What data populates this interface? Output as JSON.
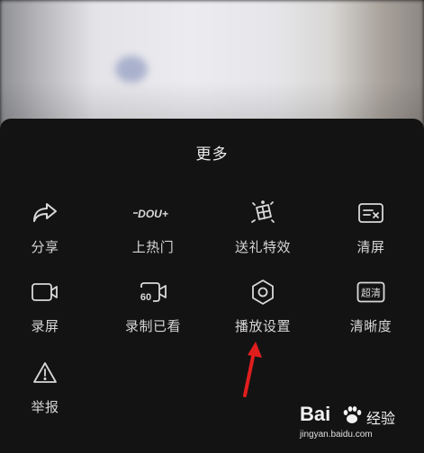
{
  "sheet": {
    "title": "更多"
  },
  "menu": [
    {
      "label": "分享",
      "icon": "share-icon"
    },
    {
      "label": "上热门",
      "icon": "dou-plus-icon"
    },
    {
      "label": "送礼特效",
      "icon": "gift-effect-icon"
    },
    {
      "label": "清屏",
      "icon": "clear-screen-icon"
    },
    {
      "label": "录屏",
      "icon": "record-screen-icon"
    },
    {
      "label": "录制已看",
      "icon": "record-watched-icon"
    },
    {
      "label": "播放设置",
      "icon": "settings-hexagon-icon"
    },
    {
      "label": "清晰度",
      "icon": "resolution-icon"
    },
    {
      "label": "举报",
      "icon": "report-warning-icon"
    }
  ],
  "icon_text": {
    "dou_plus": "DOU+",
    "resolution": "超清",
    "record_count": "60"
  },
  "watermark": {
    "brand": "Bai",
    "brand2": "经验",
    "url": "jingyan.baidu.com"
  },
  "colors": {
    "sheet_bg": "#131313",
    "text": "#d6d6d6",
    "annotation_arrow": "#e01e1e"
  }
}
